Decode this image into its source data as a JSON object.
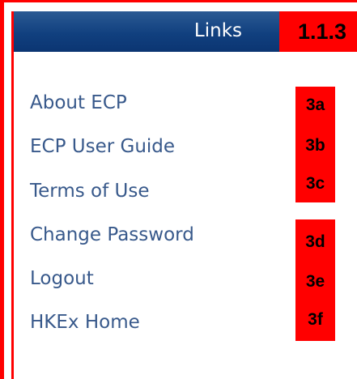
{
  "header": {
    "title": "Links",
    "section_tag": "1.1.3"
  },
  "links": [
    {
      "label": "About ECP",
      "tag": "3a"
    },
    {
      "label": "ECP User Guide",
      "tag": "3b"
    },
    {
      "label": "Terms of Use",
      "tag": "3c"
    },
    {
      "label": "Change Password",
      "tag": "3d"
    },
    {
      "label": "Logout",
      "tag": "3e"
    },
    {
      "label": "HKEx Home",
      "tag": "3f"
    }
  ],
  "colors": {
    "header_background": "#11407f",
    "link_text": "#38598b",
    "annotation": "#ff0000"
  }
}
